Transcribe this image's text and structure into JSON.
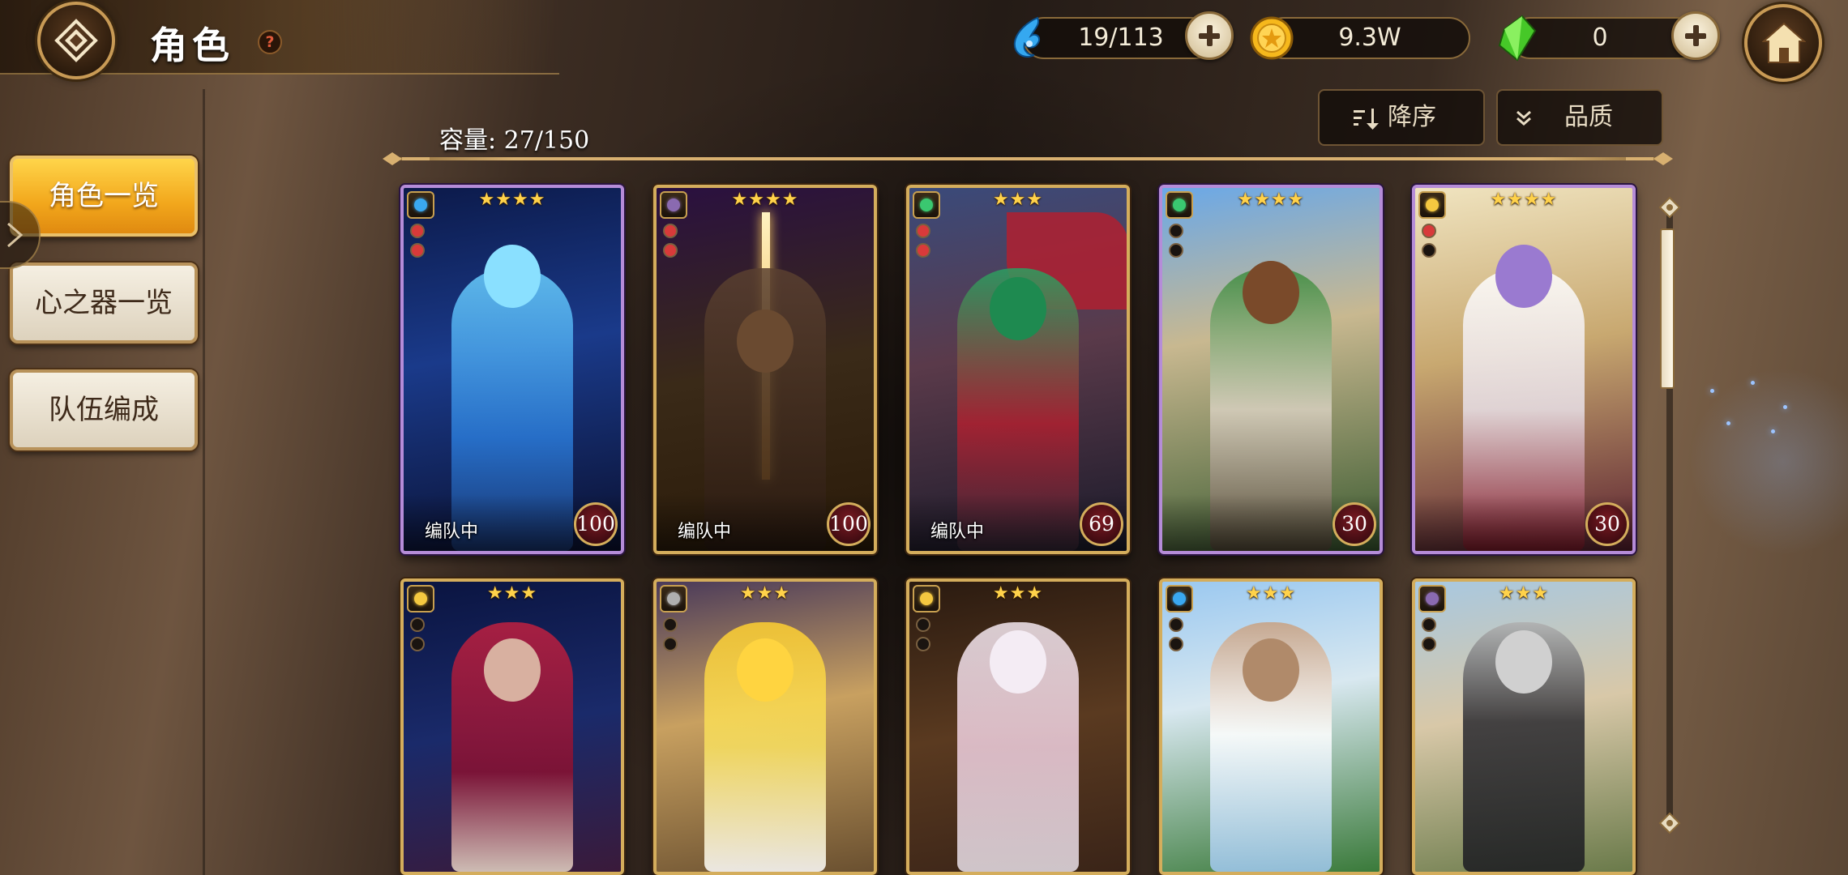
{
  "header": {
    "title": "角色",
    "help": "?"
  },
  "resources": [
    {
      "name": "stamina",
      "icon": "blue-water-drop-icon",
      "value": "19/113"
    },
    {
      "name": "gold",
      "icon": "gold-coin-icon",
      "value": "9.3W"
    },
    {
      "name": "crystal",
      "icon": "green-crystal-icon",
      "value": "0"
    }
  ],
  "nav": {
    "items": [
      {
        "label": "角色一览",
        "active": true
      },
      {
        "label": "心之器一览",
        "active": false
      },
      {
        "label": "队伍编成",
        "active": false
      }
    ]
  },
  "toolbar": {
    "capacity": "容量: 27/150",
    "sort_label": "降序",
    "filter_label": "品质"
  },
  "cards": [
    {
      "stars": "★★★★",
      "level": "100",
      "team": "编队中",
      "attribute": "water",
      "rarity": "rare"
    },
    {
      "stars": "★★★★",
      "level": "100",
      "team": "编队中",
      "attribute": "dark",
      "rarity": "normal"
    },
    {
      "stars": "★★★",
      "level": "69",
      "team": "编队中",
      "attribute": "wind",
      "rarity": "normal"
    },
    {
      "stars": "★★★★",
      "level": "30",
      "team": "",
      "attribute": "wind",
      "rarity": "rare"
    },
    {
      "stars": "★★★★",
      "level": "30",
      "team": "",
      "attribute": "light",
      "rarity": "rare"
    },
    {
      "stars": "★★★",
      "level": "",
      "team": "",
      "attribute": "light",
      "rarity": "normal"
    },
    {
      "stars": "★★★",
      "level": "",
      "team": "",
      "attribute": "neutral",
      "rarity": "normal"
    },
    {
      "stars": "★★★",
      "level": "",
      "team": "",
      "attribute": "light",
      "rarity": "normal"
    },
    {
      "stars": "★★★",
      "level": "",
      "team": "",
      "attribute": "water",
      "rarity": "normal"
    },
    {
      "stars": "★★★",
      "level": "",
      "team": "",
      "attribute": "dark",
      "rarity": "normal"
    }
  ],
  "colors": {
    "accent_gold": "#d4ad5c",
    "nav_active": "#f2a71c",
    "level_badge": "#7a1a22"
  }
}
